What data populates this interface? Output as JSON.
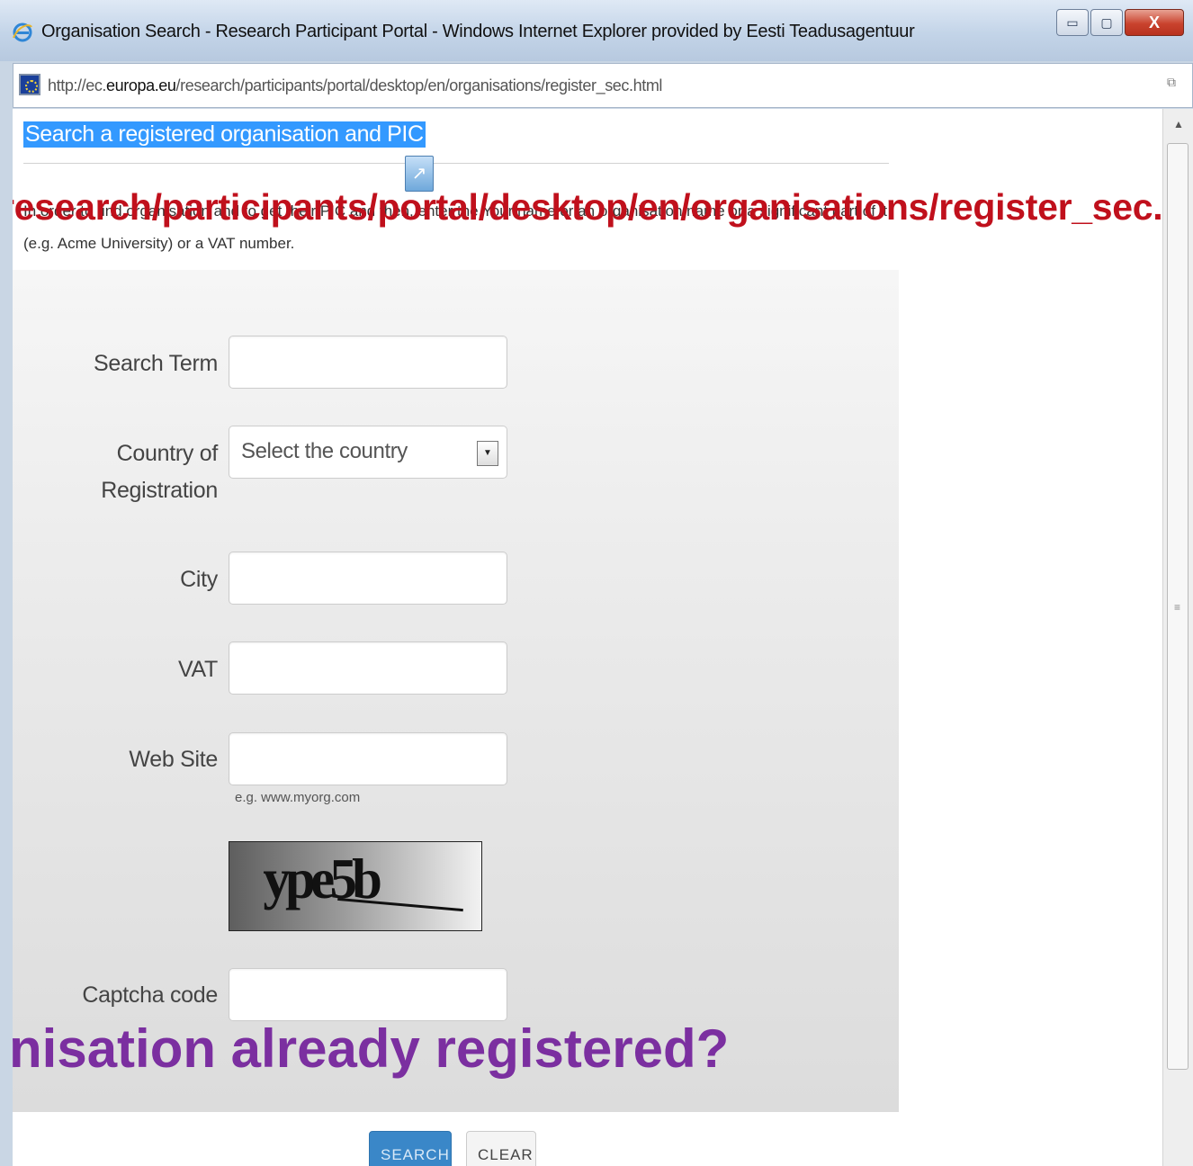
{
  "window": {
    "title": "Organisation Search - Research Participant Portal - Windows Internet Explorer provided by Eesti Teadusagentuur",
    "controls": {
      "minimize": "▭",
      "maximize": "▢",
      "close": "X"
    }
  },
  "address": {
    "url_prefix": "http://ec.",
    "url_domain": "europa.eu",
    "url_path": "/research/participants/portal/desktop/en/organisations/register_sec.html"
  },
  "page": {
    "heading": "Search a registered organisation and PIC",
    "intro": "In order to find organisation and to get their PIC and then, enter the Your name or an organisation name or a significant part of it (e.g. Acme University) or a VAT number.",
    "overlay_url": "research/participants/portal/desktop/en/organisations/register_sec.html",
    "overlay_question": "nisation already registered?"
  },
  "form": {
    "search_term": {
      "label": "Search Term",
      "value": ""
    },
    "country": {
      "label": "Country of Registration",
      "selected": "Select the country"
    },
    "city": {
      "label": "City",
      "value": ""
    },
    "vat": {
      "label": "VAT",
      "value": ""
    },
    "website": {
      "label": "Web Site",
      "value": "",
      "hint": "e.g. www.myorg.com"
    },
    "captcha": {
      "image_text": "ype5b",
      "label": "Captcha code",
      "value": ""
    },
    "search_button": "SEARCH",
    "clear_button": "CLEAR"
  }
}
